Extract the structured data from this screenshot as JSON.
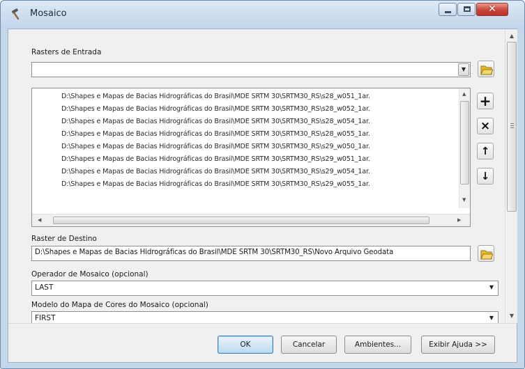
{
  "window": {
    "title": "Mosaico",
    "title_icon": "hammer-tool-icon",
    "controls": {
      "minimize": "minimize-icon",
      "maximize": "maximize-icon",
      "close": "✕"
    }
  },
  "rasters_entrada": {
    "label": "Rasters de Entrada",
    "combo_value": "",
    "items": [
      "D:\\Shapes e Mapas de Bacias Hidrográficas do Brasil\\MDE SRTM 30\\SRTM30_RS\\s28_w051_1ar.",
      "D:\\Shapes e Mapas de Bacias Hidrográficas do Brasil\\MDE SRTM 30\\SRTM30_RS\\s28_w052_1ar.",
      "D:\\Shapes e Mapas de Bacias Hidrográficas do Brasil\\MDE SRTM 30\\SRTM30_RS\\s28_w054_1ar.",
      "D:\\Shapes e Mapas de Bacias Hidrográficas do Brasil\\MDE SRTM 30\\SRTM30_RS\\s28_w055_1ar.",
      "D:\\Shapes e Mapas de Bacias Hidrográficas do Brasil\\MDE SRTM 30\\SRTM30_RS\\s29_w050_1ar.",
      "D:\\Shapes e Mapas de Bacias Hidrográficas do Brasil\\MDE SRTM 30\\SRTM30_RS\\s29_w051_1ar.",
      "D:\\Shapes e Mapas de Bacias Hidrográficas do Brasil\\MDE SRTM 30\\SRTM30_RS\\s29_w054_1ar.",
      "D:\\Shapes e Mapas de Bacias Hidrográficas do Brasil\\MDE SRTM 30\\SRTM30_RS\\s29_w055_1ar."
    ],
    "side_buttons": {
      "add": "+",
      "remove": "×",
      "up": "↑",
      "down": "↓"
    }
  },
  "raster_destino": {
    "label": "Raster de Destino",
    "value": "D:\\Shapes e Mapas de Bacias Hidrográficas do Brasil\\MDE SRTM 30\\SRTM30_RS\\Novo Arquivo Geodata"
  },
  "operador_mosaico": {
    "label": "Operador de Mosaico (opcional)",
    "value": "LAST"
  },
  "modelo_cores": {
    "label": "Modelo do Mapa de Cores do Mosaico (opcional)",
    "value": "FIRST"
  },
  "footer": {
    "ok": "OK",
    "cancelar": "Cancelar",
    "ambientes": "Ambientes...",
    "ajuda": "Exibir Ajuda >>"
  },
  "colors": {
    "title_bar": "#c3d5ea",
    "close_button": "#c9453a",
    "default_button": "#bcdcf3",
    "folder_icon": "#e8b830"
  }
}
